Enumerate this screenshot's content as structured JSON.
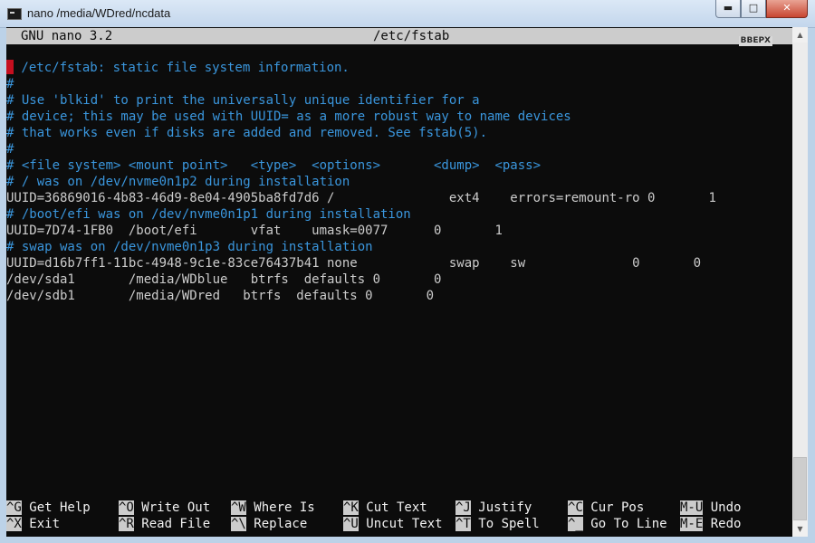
{
  "window": {
    "title": "nano /media/WDred/ncdata",
    "controls": {
      "minimize": "▬",
      "maximize": "□",
      "close": "✕"
    }
  },
  "header": {
    "version": "GNU nano 3.2",
    "filename": "/etc/fstab",
    "scroll_label": "ВВЕРХ"
  },
  "editor": {
    "lines": [
      {
        "type": "comment",
        "text": " /etc/fstab: static file system information."
      },
      {
        "type": "comment",
        "text": "#"
      },
      {
        "type": "comment",
        "text": "# Use 'blkid' to print the universally unique identifier for a"
      },
      {
        "type": "comment",
        "text": "# device; this may be used with UUID= as a more robust way to name devices"
      },
      {
        "type": "comment",
        "text": "# that works even if disks are added and removed. See fstab(5)."
      },
      {
        "type": "comment",
        "text": "#"
      },
      {
        "type": "comment",
        "text": "# <file system> <mount point>   <type>  <options>       <dump>  <pass>"
      },
      {
        "type": "comment",
        "text": "# / was on /dev/nvme0n1p2 during installation"
      },
      {
        "type": "text",
        "text": "UUID=36869016-4b83-46d9-8e04-4905ba8fd7d6 /               ext4    errors=remount-ro 0       1"
      },
      {
        "type": "comment",
        "text": "# /boot/efi was on /dev/nvme0n1p1 during installation"
      },
      {
        "type": "text",
        "text": "UUID=7D74-1FB0  /boot/efi       vfat    umask=0077      0       1"
      },
      {
        "type": "comment",
        "text": "# swap was on /dev/nvme0n1p3 during installation"
      },
      {
        "type": "text",
        "text": "UUID=d16b7ff1-11bc-4948-9c1e-83ce76437b41 none            swap    sw              0       0"
      },
      {
        "type": "text",
        "text": "/dev/sda1       /media/WDblue   btrfs  defaults 0       0"
      },
      {
        "type": "text",
        "text": "/dev/sdb1       /media/WDred   btrfs  defaults 0       0"
      }
    ]
  },
  "shortcuts": [
    {
      "key": "^G",
      "label": " Get Help"
    },
    {
      "key": "^O",
      "label": " Write Out"
    },
    {
      "key": "^W",
      "label": " Where Is"
    },
    {
      "key": "^K",
      "label": " Cut Text"
    },
    {
      "key": "^J",
      "label": " Justify"
    },
    {
      "key": "^C",
      "label": " Cur Pos"
    },
    {
      "key": "M-U",
      "label": " Undo"
    },
    {
      "key": "^X",
      "label": " Exit"
    },
    {
      "key": "^R",
      "label": " Read File"
    },
    {
      "key": "^\\",
      "label": " Replace"
    },
    {
      "key": "^U",
      "label": " Uncut Text"
    },
    {
      "key": "^T",
      "label": " To Spell"
    },
    {
      "key": "^_",
      "label": " Go To Line"
    },
    {
      "key": "M-E",
      "label": " Redo"
    }
  ],
  "colors": {
    "comment": "#3a96dd",
    "text": "#cccccc",
    "cursor": "#c50f1f",
    "background": "#0c0c0c"
  }
}
